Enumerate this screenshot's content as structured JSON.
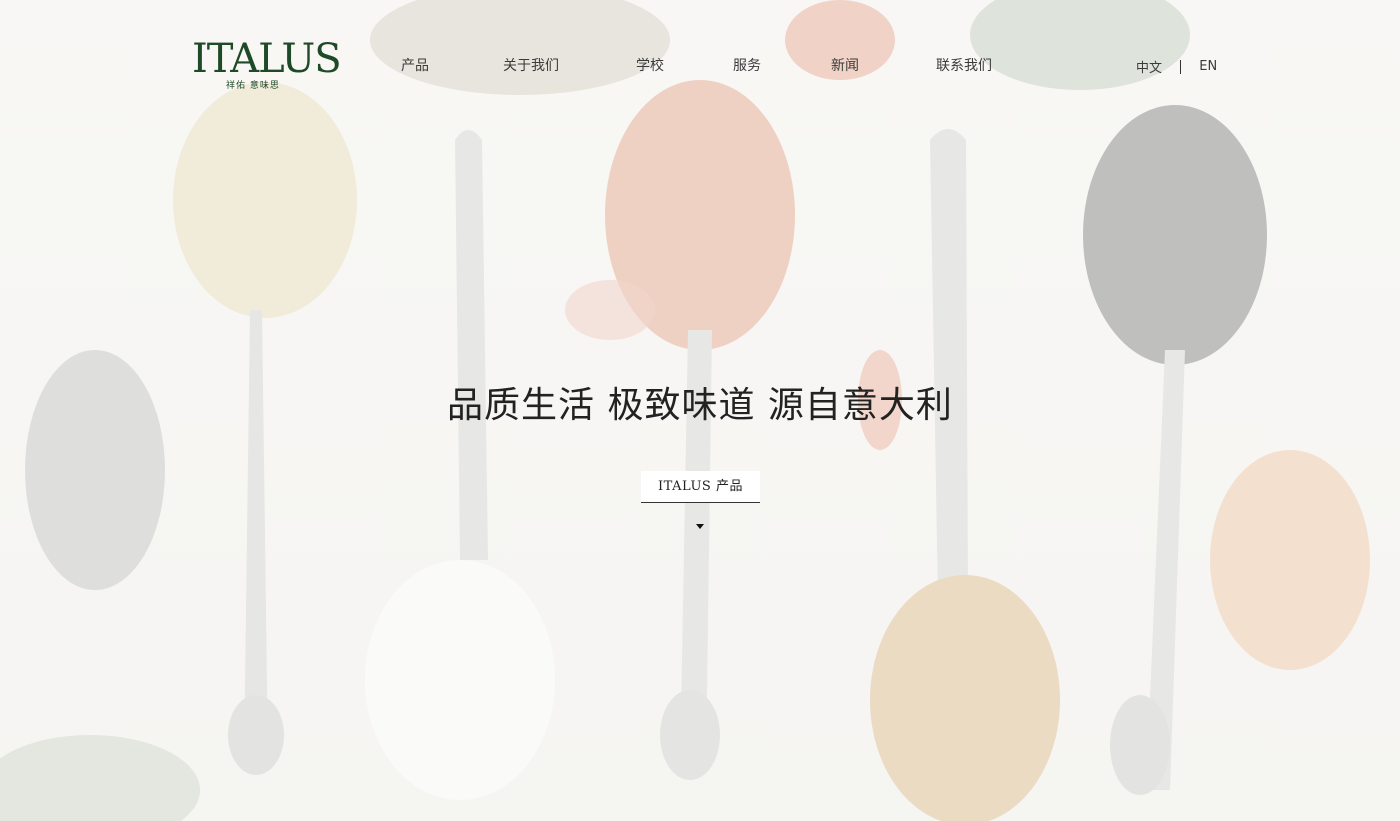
{
  "brand": {
    "logo_text": "ITALUS",
    "logo_subtitle": "祥佑 意味思"
  },
  "nav": {
    "items": [
      {
        "label": "产品"
      },
      {
        "label": "关于我们"
      },
      {
        "label": "学校"
      },
      {
        "label": "服务"
      },
      {
        "label": "新闻"
      },
      {
        "label": "联系我们"
      }
    ]
  },
  "language": {
    "zh": "中文",
    "en": "EN"
  },
  "hero": {
    "headline": "品质生活 极致味道 源自意大利",
    "cta_label": "ITALUS 产品"
  },
  "colors": {
    "brand_green": "#1f4a28",
    "text_dark": "#222222"
  }
}
